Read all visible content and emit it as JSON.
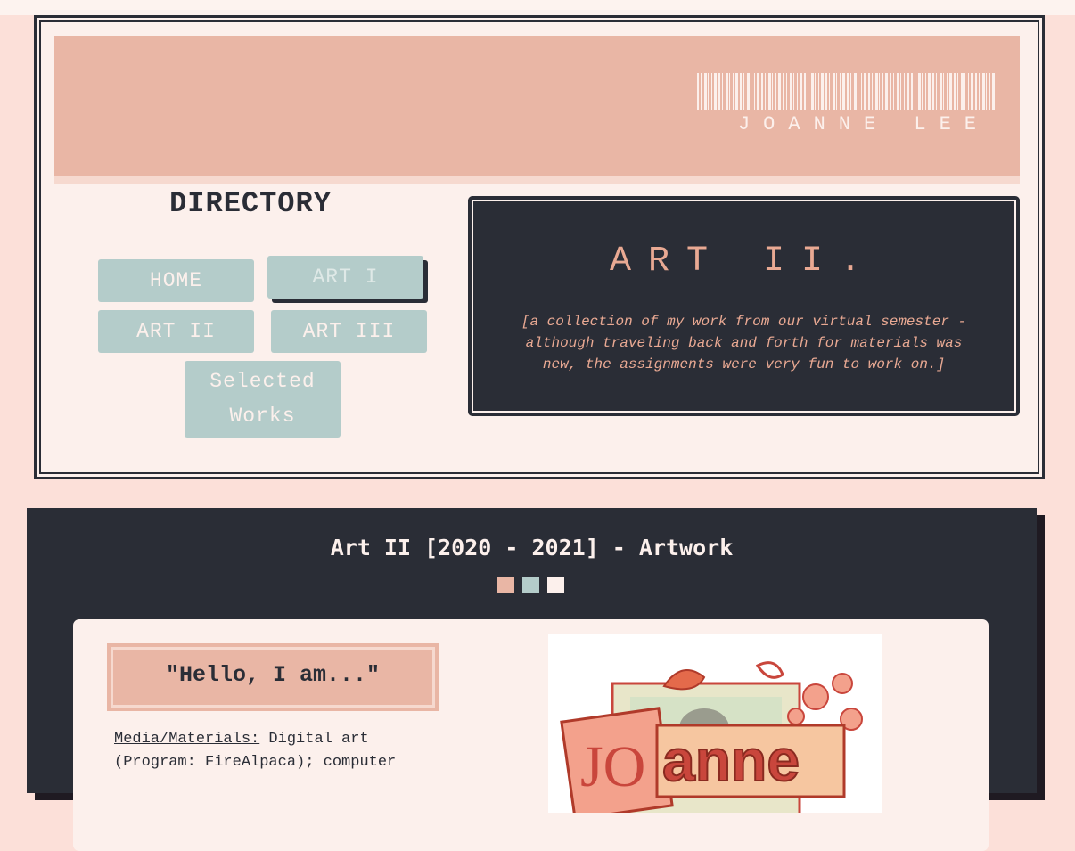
{
  "header": {
    "brand_name": "JOANNE LEE",
    "barcode_icon": "barcode-icon"
  },
  "directory": {
    "title": "DIRECTORY",
    "buttons": [
      {
        "label": "HOME",
        "state": "normal"
      },
      {
        "label": "ART I",
        "state": "active"
      },
      {
        "label": "ART II",
        "state": "normal"
      },
      {
        "label": "ART III",
        "state": "normal"
      },
      {
        "label": "Selected Works",
        "line1": "Selected",
        "line2": "Works",
        "state": "normal"
      }
    ]
  },
  "panel": {
    "title": "ART II.",
    "description": "[a collection of my work from our virtual semester - although traveling back and forth for materials was new, the assignments were very fun to work on.]"
  },
  "section": {
    "title": "Art II [2020 - 2021] - Artwork",
    "swatches": [
      "#e9b6a5",
      "#b4ccca",
      "#fcf0ec"
    ]
  },
  "artwork_card": {
    "heading": "\"Hello, I am...\"",
    "media_label": "Media/Materials:",
    "media_text": " Digital art (Program: FireAlpaca); computer",
    "image_text_a": "JO",
    "image_text_b": "anne"
  },
  "colors": {
    "pink": "#e9b6a5",
    "sage": "#b4ccca",
    "cream": "#fcf0ec",
    "dark": "#2a2d36",
    "salmon_text": "#e9a993"
  }
}
